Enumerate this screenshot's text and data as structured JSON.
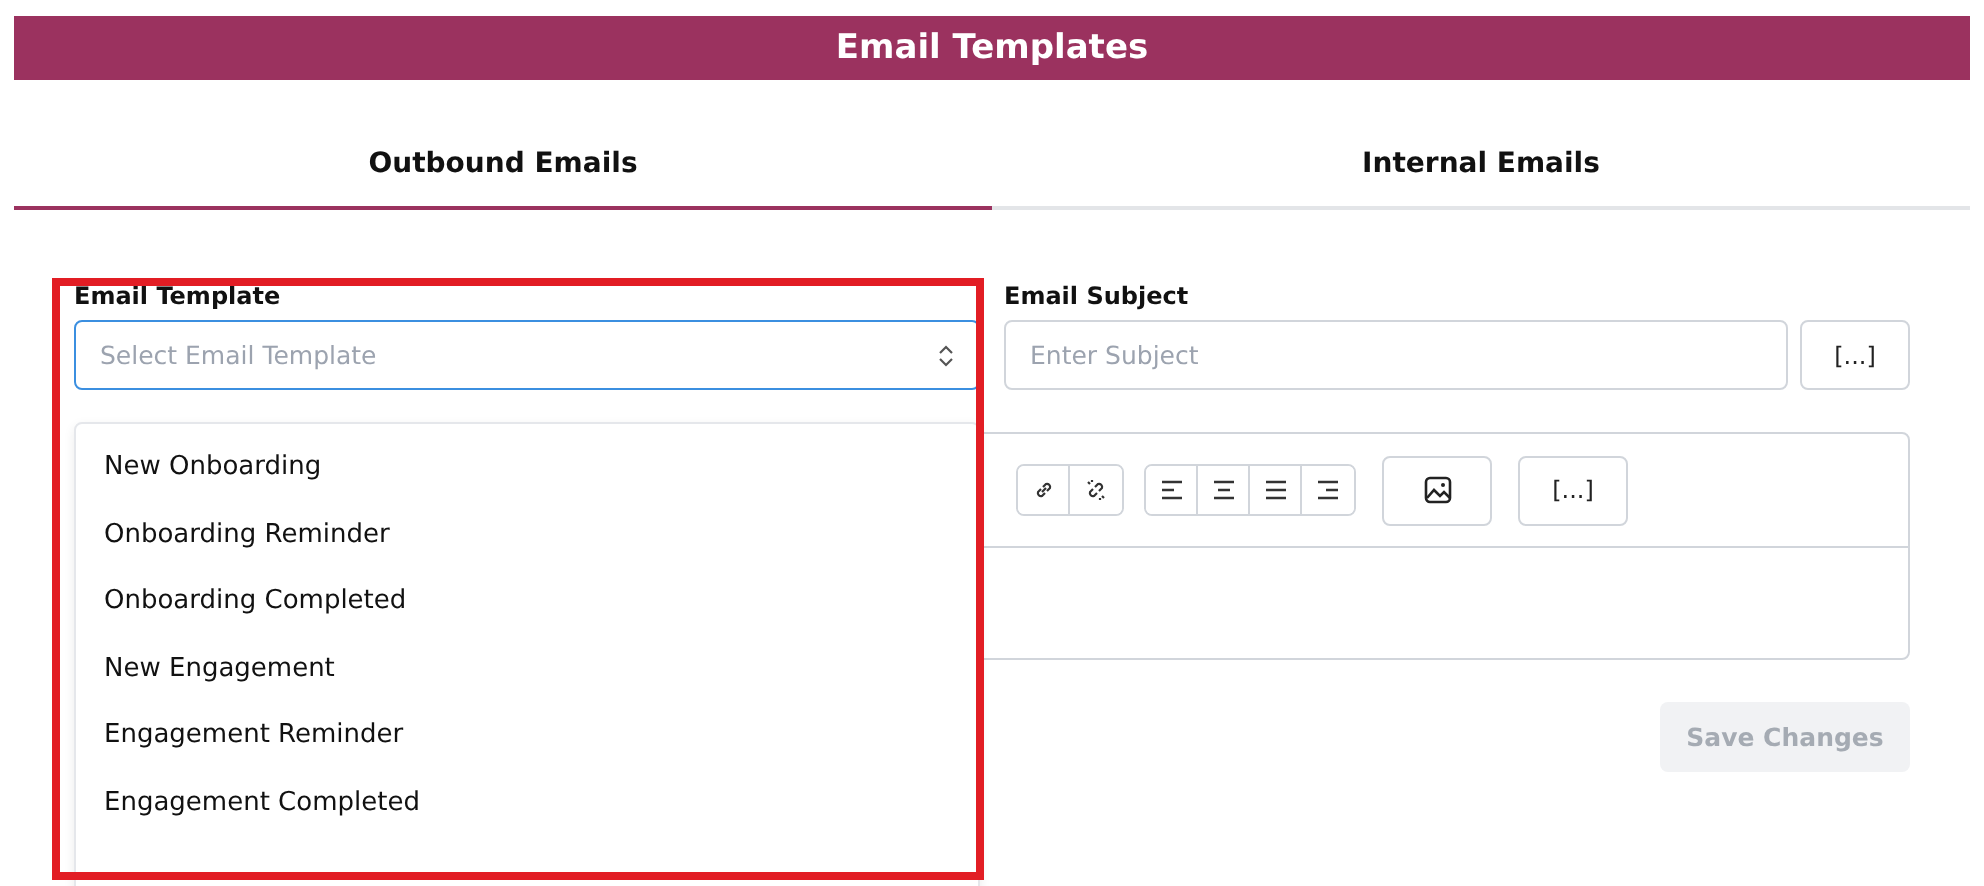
{
  "header": {
    "title": "Email Templates"
  },
  "tabs": [
    {
      "label": "Outbound Emails",
      "selected": true
    },
    {
      "label": "Internal Emails",
      "selected": false
    }
  ],
  "template_select": {
    "label": "Email Template",
    "placeholder": "Select Email Template",
    "options": [
      "New Onboarding",
      "Onboarding Reminder",
      "Onboarding Completed",
      "New Engagement",
      "Engagement Reminder",
      "Engagement Completed"
    ]
  },
  "subject": {
    "label": "Email Subject",
    "placeholder": "Enter Subject",
    "insert_button": "[...]"
  },
  "editor": {
    "insert_button": "[...]"
  },
  "save_button": {
    "label": "Save Changes",
    "disabled": true
  }
}
